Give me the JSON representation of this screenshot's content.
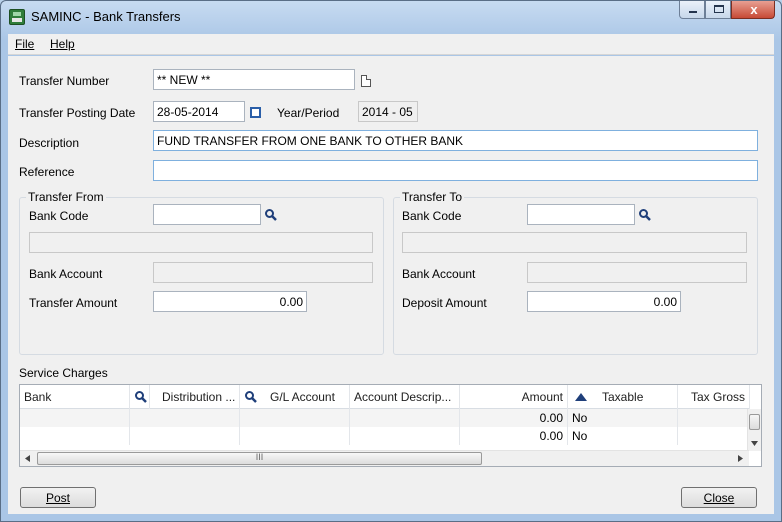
{
  "window": {
    "title": "SAMINC - Bank Transfers",
    "close_glyph": "x"
  },
  "menu": [
    {
      "label": "File"
    },
    {
      "label": "Help"
    }
  ],
  "form": {
    "transfer_number_label": "Transfer Number",
    "transfer_number_value": "** NEW **",
    "posting_date_label": "Transfer Posting Date",
    "posting_date_value": "28-05-2014",
    "year_period_label": "Year/Period",
    "year_period_value": "2014 - 05",
    "description_label": "Description",
    "description_value": "FUND TRANSFER FROM ONE BANK TO OTHER BANK",
    "reference_label": "Reference",
    "reference_value": ""
  },
  "transfer_from": {
    "title": "Transfer From",
    "bank_code_label": "Bank Code",
    "bank_code_value": "",
    "bank_name_value": "",
    "bank_account_label": "Bank Account",
    "bank_account_value": "",
    "amount_label": "Transfer Amount",
    "amount_value": "0.00"
  },
  "transfer_to": {
    "title": "Transfer To",
    "bank_code_label": "Bank Code",
    "bank_code_value": "",
    "bank_name_value": "",
    "bank_account_label": "Bank Account",
    "bank_account_value": "",
    "amount_label": "Deposit Amount",
    "amount_value": "0.00"
  },
  "service_charges": {
    "title": "Service Charges",
    "columns": [
      "Bank",
      "Distribution ...",
      "G/L Account",
      "Account Descrip...",
      "Amount",
      "Taxable",
      "Tax Gross"
    ],
    "rows": [
      {
        "amount": "0.00",
        "taxable": "No"
      },
      {
        "amount": "0.00",
        "taxable": "No"
      }
    ],
    "hscroll_grip": "III"
  },
  "buttons": {
    "post": "Post",
    "close": "Close"
  }
}
